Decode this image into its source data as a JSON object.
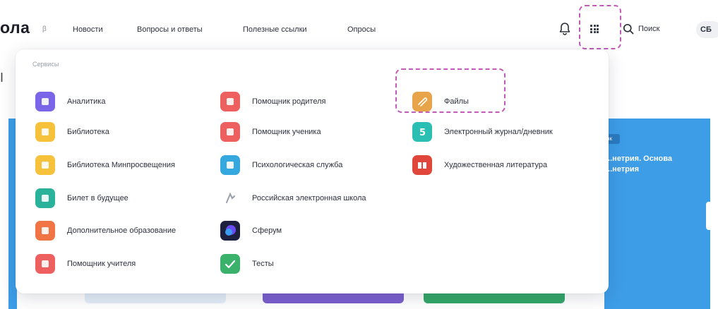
{
  "header": {
    "logo_text": "ола",
    "logo_beta": "β",
    "nav": [
      "Новости",
      "Вопросы и ответы",
      "Полезные ссылки",
      "Опросы"
    ],
    "search_label": "Поиск",
    "user_initials": "СБ"
  },
  "background": {
    "left_partial_text": "I",
    "card_chip": "ок",
    "card_title": "...нетрия. Основа ...нетрия"
  },
  "services_menu": {
    "heading": "Сервисы",
    "columns": [
      [
        {
          "label": "Аналитика",
          "icon": "analytics-icon",
          "color": "#7a65e8"
        },
        {
          "label": "Библиотека",
          "icon": "library-icon",
          "color": "#f6c23c"
        },
        {
          "label": "Библиотека Минпросвещения",
          "icon": "minpros-library-icon",
          "color": "#f6c23c"
        },
        {
          "label": "Билет в будущее",
          "icon": "ticket-future-icon",
          "color": "#2bb29a"
        },
        {
          "label": "Дополнительное образование",
          "icon": "extra-education-icon",
          "color": "#f07444"
        },
        {
          "label": "Помощник учителя",
          "icon": "teacher-helper-icon",
          "color": "#ee5f5f"
        }
      ],
      [
        {
          "label": "Помощник родителя",
          "icon": "parent-helper-icon",
          "color": "#ee5f5f"
        },
        {
          "label": "Помощник ученика",
          "icon": "student-helper-icon",
          "color": "#ee5f5f"
        },
        {
          "label": "Психологическая служба",
          "icon": "psychology-icon",
          "color": "#35a8e0"
        },
        {
          "label": "Российская электронная школа",
          "icon": "resh-icon",
          "color": "#d8d8d8"
        },
        {
          "label": "Сферум",
          "icon": "sferum-icon",
          "color": "#3b3fc8"
        },
        {
          "label": "Тесты",
          "icon": "tests-icon",
          "color": "#3ab26b"
        }
      ],
      [
        {
          "label": "Файлы",
          "icon": "files-icon",
          "color": "#e8a44a"
        },
        {
          "label": "Электронный журнал/дневник",
          "icon": "e-journal-icon",
          "color": "#2bbfb4"
        },
        {
          "label": "Художественная литература",
          "icon": "fiction-icon",
          "color": "#e0463a"
        }
      ]
    ]
  }
}
